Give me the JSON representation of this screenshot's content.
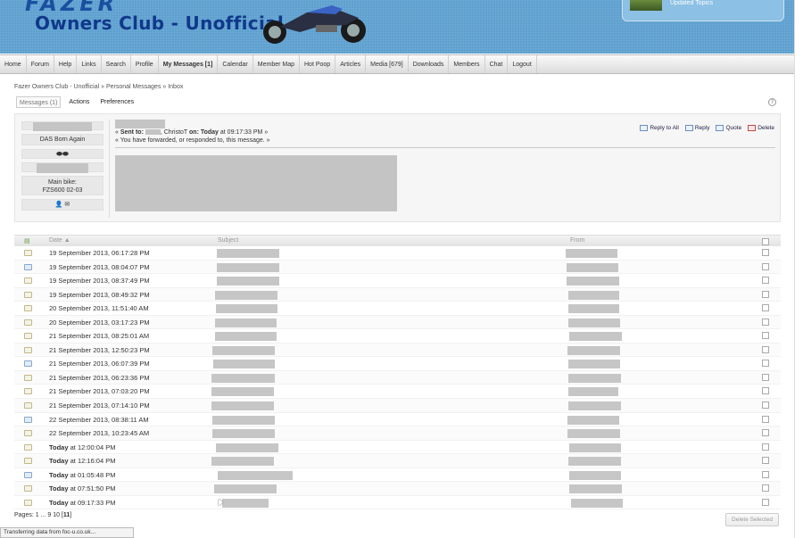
{
  "header": {
    "logo_top": "FAZER",
    "title": "Owners Club - Unofficial",
    "updated_topics": "Updated Topics"
  },
  "nav": [
    {
      "label": "Home"
    },
    {
      "label": "Forum"
    },
    {
      "label": "Help"
    },
    {
      "label": "Links"
    },
    {
      "label": "Search"
    },
    {
      "label": "Profile"
    },
    {
      "label": "My Messages [1]",
      "active": true
    },
    {
      "label": "Calendar"
    },
    {
      "label": "Member Map"
    },
    {
      "label": "Hot Poop"
    },
    {
      "label": "Articles"
    },
    {
      "label": "Media [679]"
    },
    {
      "label": "Downloads"
    },
    {
      "label": "Members"
    },
    {
      "label": "Chat"
    },
    {
      "label": "Logout"
    }
  ],
  "breadcrumb": "Fazer Owners Club - Unofficial » Personal Messages » Inbox",
  "tabs": {
    "messages": "Messages (1)",
    "actions": "Actions",
    "preferences": "Preferences"
  },
  "help_label": "?",
  "user": {
    "rank": "DAS Born Again",
    "bike_label": "Main bike:",
    "bike_value": "FZS600 02-03"
  },
  "message": {
    "sent_to_prefix": "« ",
    "sent_to_label": "Sent to:",
    "sent_to_names": ", ChristoT ",
    "on_label": "on:",
    "on_value": " Today",
    "time_text": " at 09:17:33 PM »",
    "forwarded_note": "« You have forwarded, or responded to, this message. »",
    "actions": {
      "reply_all": "Reply to All",
      "reply": "Reply",
      "quote": "Quote",
      "delete": "Delete"
    }
  },
  "table": {
    "headers": {
      "date": "Date",
      "subject": "Subject",
      "from": "From"
    },
    "rows": [
      {
        "date": "19 September 2013, 06:17:28 PM",
        "read": true
      },
      {
        "date": "19 September 2013, 08:04:07 PM",
        "read": false
      },
      {
        "date": "19 September 2013, 08:37:49 PM",
        "read": true
      },
      {
        "date": "19 September 2013, 08:49:32 PM",
        "read": true
      },
      {
        "date": "20 September 2013, 11:51:40 AM",
        "read": true
      },
      {
        "date": "20 September 2013, 03:17:23 PM",
        "read": true
      },
      {
        "date": "21 September 2013, 08:25:01 AM",
        "read": true
      },
      {
        "date": "21 September 2013, 12:50:23 PM",
        "read": true
      },
      {
        "date": "21 September 2013, 06:07:39 PM",
        "read": false
      },
      {
        "date": "21 September 2013, 06:23:36 PM",
        "read": true
      },
      {
        "date": "21 September 2013, 07:03:20 PM",
        "read": true
      },
      {
        "date": "21 September 2013, 07:14:10 PM",
        "read": true
      },
      {
        "date": "22 September 2013, 08:38:11 AM",
        "read": false
      },
      {
        "date": "22 September 2013, 10:23:45 AM",
        "read": true
      },
      {
        "today": "Today",
        "date": " at 12:00:04 PM",
        "read": true
      },
      {
        "today": "Today",
        "date": " at 12:16:04 PM",
        "read": true
      },
      {
        "today": "Today",
        "date": " at 01:05:48 PM",
        "read": false
      },
      {
        "today": "Today",
        "date": " at 07:51:50 PM",
        "read": true
      },
      {
        "today": "Today",
        "date": " at 09:17:33 PM",
        "read": true
      }
    ]
  },
  "pagination": {
    "prefix": "Pages: 1 ... 9 10 [",
    "current": "11",
    "suffix": "]"
  },
  "delete_selected": "Delete Selected",
  "statusbar": "Transferring data from foc-u.co.uk..."
}
